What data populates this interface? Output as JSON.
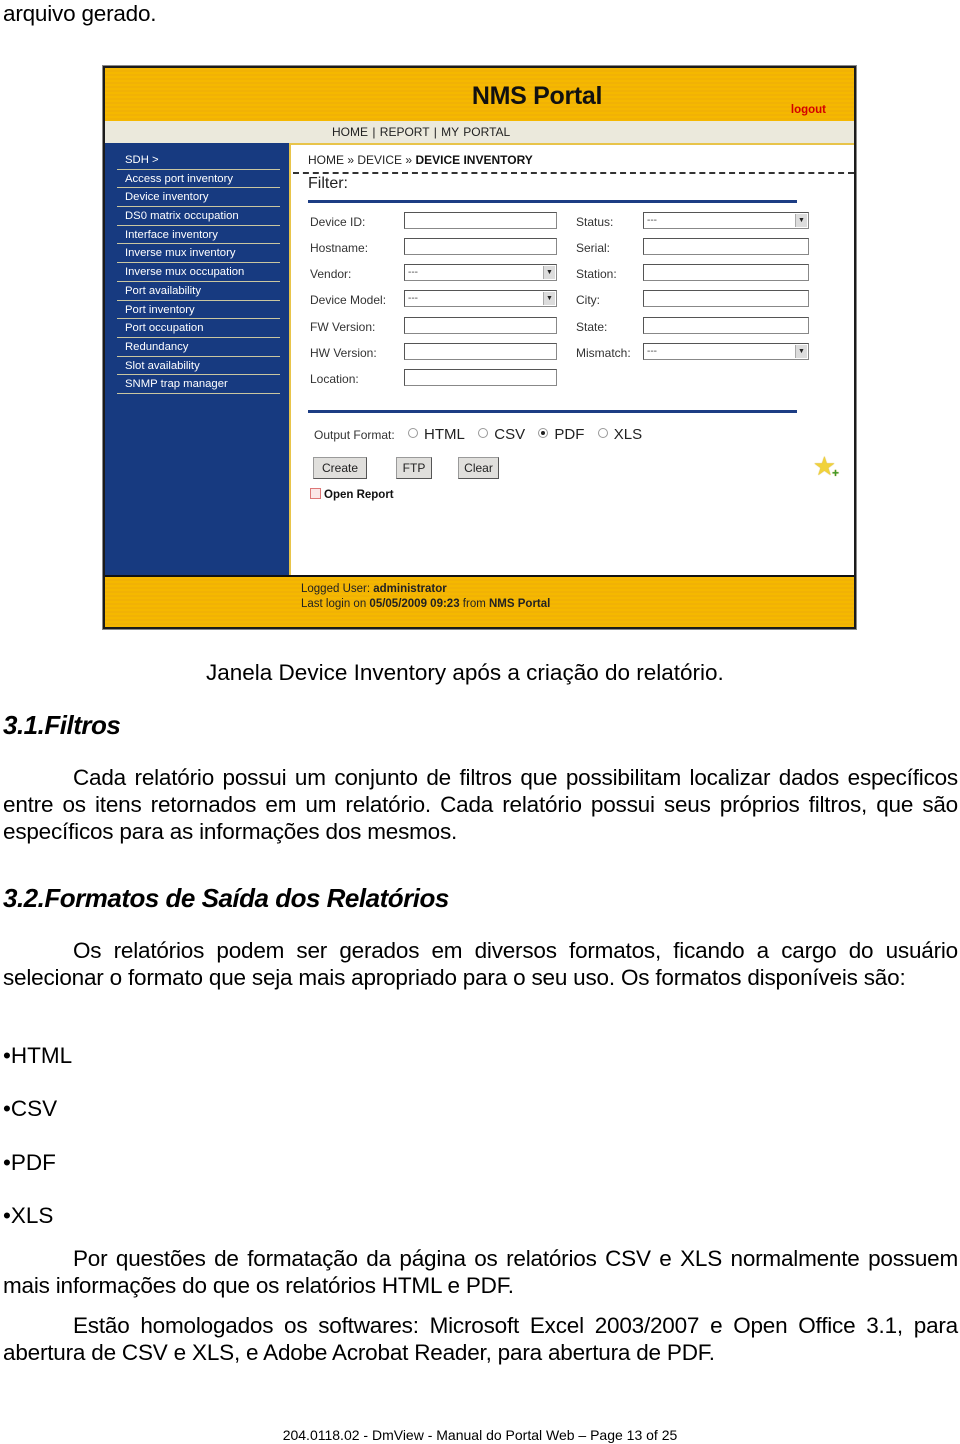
{
  "document": {
    "top_fragment": "arquivo gerado.",
    "figure_caption": "Janela Device Inventory após a criação do relatório.",
    "section_1": {
      "heading": "3.1.Filtros",
      "paragraph": "Cada relatório possui um conjunto de filtros que possibilitam localizar dados específicos entre os itens retornados em um relatório.  Cada relatório possui seus próprios filtros, que são específicos para as informações dos mesmos."
    },
    "section_2": {
      "heading": "3.2.Formatos de Saída dos Relatórios",
      "paragraph": "Os relatórios podem ser gerados em diversos formatos, ficando a cargo do usuário selecionar o formato que seja mais apropriado para o seu uso. Os formatos disponíveis são:",
      "bullets": [
        "•HTML",
        "•CSV",
        "•PDF",
        "•XLS"
      ],
      "paragraph_2": "Por questões de formatação da página os relatórios CSV e XLS normalmente possuem mais informações do que os relatórios HTML e PDF.",
      "paragraph_3": "Estão homologados os softwares: Microsoft Excel 2003/2007 e Open Office 3.1, para abertura de CSV e XLS, e Adobe Acrobat Reader, para abertura de PDF."
    },
    "footer": "204.0118.02 - DmView  - Manual do Portal Web – Page 13 of 25"
  },
  "portal": {
    "title": "NMS Portal",
    "logout_label": "logout",
    "nav": [
      "HOME",
      "REPORT",
      "MY PORTAL"
    ],
    "sidebar": [
      "SDH >",
      "Access port inventory",
      "Device inventory",
      "DS0 matrix occupation",
      "Interface inventory",
      "Inverse mux inventory",
      "Inverse mux occupation",
      "Port availability",
      "Port inventory",
      "Port occupation",
      "Redundancy",
      "Slot availability",
      "SNMP trap manager"
    ],
    "breadcrumb": {
      "home": "HOME",
      "sep": "»",
      "device": "DEVICE",
      "current": "DEVICE INVENTORY"
    },
    "filter_title": "Filter:",
    "fields_left": [
      {
        "label": "Device ID:",
        "type": "text",
        "value": ""
      },
      {
        "label": "Hostname:",
        "type": "text",
        "value": ""
      },
      {
        "label": "Vendor:",
        "type": "select",
        "value": "---"
      },
      {
        "label": "Device Model:",
        "type": "select",
        "value": "---"
      },
      {
        "label": "FW Version:",
        "type": "text",
        "value": ""
      },
      {
        "label": "HW Version:",
        "type": "text",
        "value": ""
      },
      {
        "label": "Location:",
        "type": "text",
        "value": ""
      }
    ],
    "fields_right": [
      {
        "label": "Status:",
        "type": "select",
        "value": "---"
      },
      {
        "label": "Serial:",
        "type": "text",
        "value": ""
      },
      {
        "label": "Station:",
        "type": "text",
        "value": ""
      },
      {
        "label": "City:",
        "type": "text",
        "value": ""
      },
      {
        "label": "State:",
        "type": "text",
        "value": ""
      },
      {
        "label": "Mismatch:",
        "type": "select",
        "value": "---"
      }
    ],
    "output_format": {
      "label": "Output Format:",
      "options": [
        "HTML",
        "CSV",
        "PDF",
        "XLS"
      ],
      "selected": "PDF"
    },
    "buttons": {
      "create": "Create",
      "ftp": "FTP",
      "clear": "Clear"
    },
    "open_report": "Open Report",
    "icons": {
      "favorite": "star-add-icon",
      "open_report": "report-icon"
    },
    "login": {
      "user_label": "Logged User:",
      "user": "administrator",
      "last_login_label": "Last login on",
      "last_login": "05/05/2009 09:23",
      "from_label": "from",
      "from": "NMS Portal"
    },
    "colors": {
      "banner": "#f5b800",
      "sidebar": "#173a80",
      "logout": "#d40000"
    }
  }
}
